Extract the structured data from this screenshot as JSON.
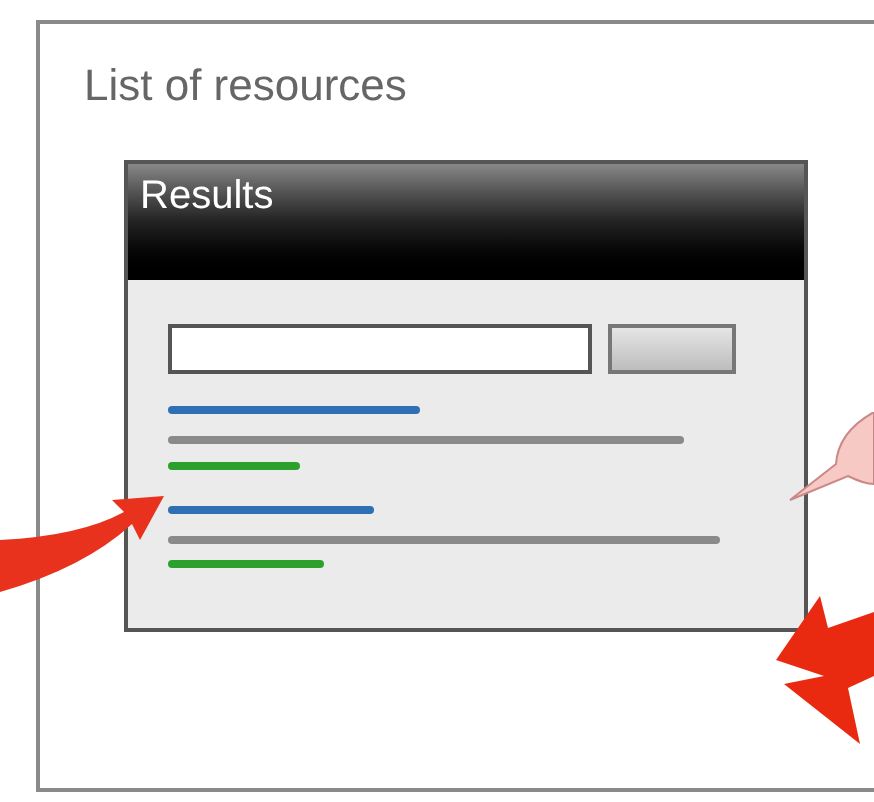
{
  "title": "List of resources",
  "panel": {
    "title": "Results"
  }
}
